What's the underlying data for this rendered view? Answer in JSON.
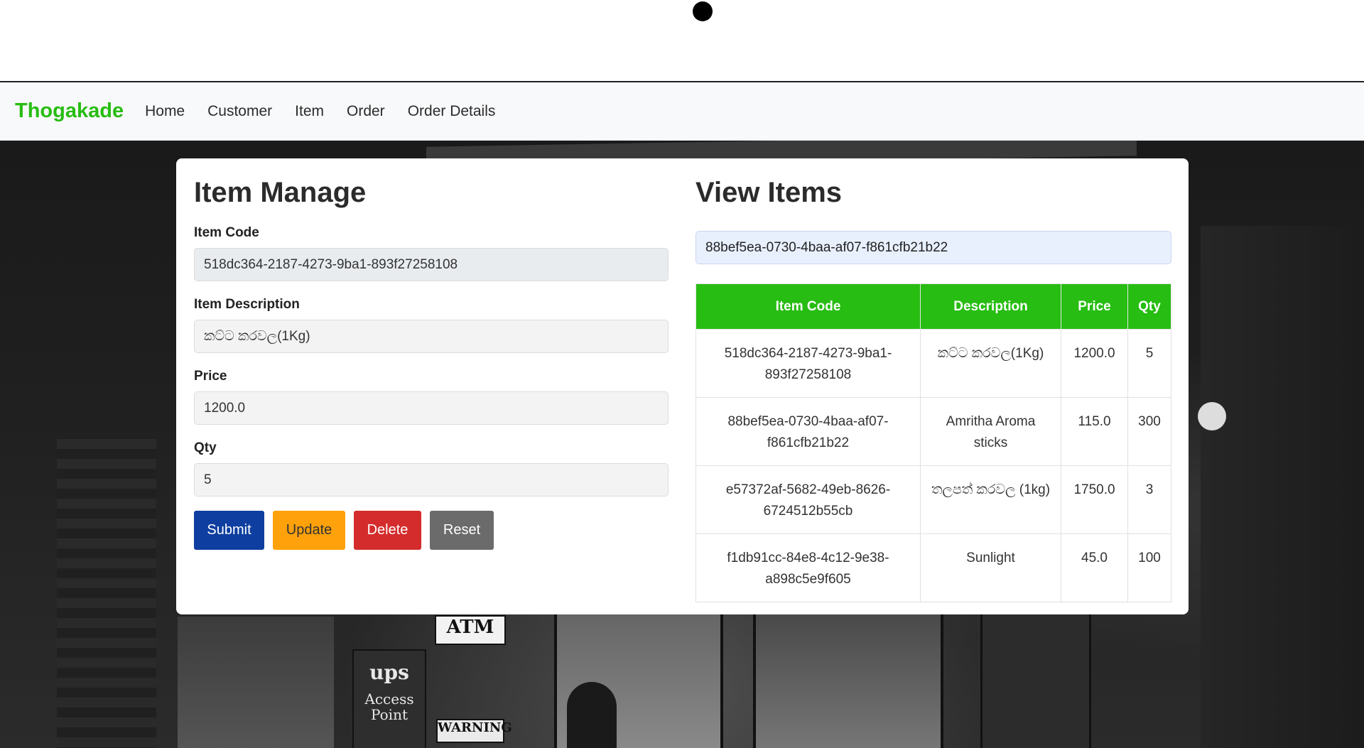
{
  "navbar": {
    "brand": "Thogakade",
    "links": [
      "Home",
      "Customer",
      "Item",
      "Order",
      "Order Details"
    ]
  },
  "form": {
    "title": "Item Manage",
    "item_code_label": "Item Code",
    "item_code_value": "518dc364-2187-4273-9ba1-893f27258108",
    "description_label": "Item Description",
    "description_value": "කට්ට කරවල(1Kg)",
    "price_label": "Price",
    "price_value": "1200.0",
    "qty_label": "Qty",
    "qty_value": "5",
    "buttons": {
      "submit": "Submit",
      "update": "Update",
      "delete": "Delete",
      "reset": "Reset"
    }
  },
  "view": {
    "title": "View Items",
    "search_value": "88bef5ea-0730-4baa-af07-f861cfb21b22",
    "table": {
      "headers": [
        "Item Code",
        "Description",
        "Price",
        "Qty"
      ],
      "rows": [
        [
          "518dc364-2187-4273-9ba1-893f27258108",
          "කට්ට කරවල(1Kg)",
          "1200.0",
          "5"
        ],
        [
          "88bef5ea-0730-4baa-af07-f861cfb21b22",
          "Amritha Aroma sticks",
          "115.0",
          "300"
        ],
        [
          "e57372af-5682-49eb-8626-6724512b55cb",
          "තලපත් කරවල (1kg)",
          "1750.0",
          "3"
        ],
        [
          "f1db91cc-84e8-4c12-9e38-a898c5e9f605",
          "Sunlight",
          "45.0",
          "100"
        ]
      ]
    }
  },
  "background_signs": {
    "atm": "ATM",
    "ups": "ups",
    "access_point": "Access Point",
    "warning": "WARNING"
  },
  "colors": {
    "brand": "#27bd12",
    "table_header": "#27bd12",
    "submit": "#0e3fa0",
    "update": "#ffa10a",
    "delete": "#d42c2c",
    "reset": "#6b6b6b"
  }
}
